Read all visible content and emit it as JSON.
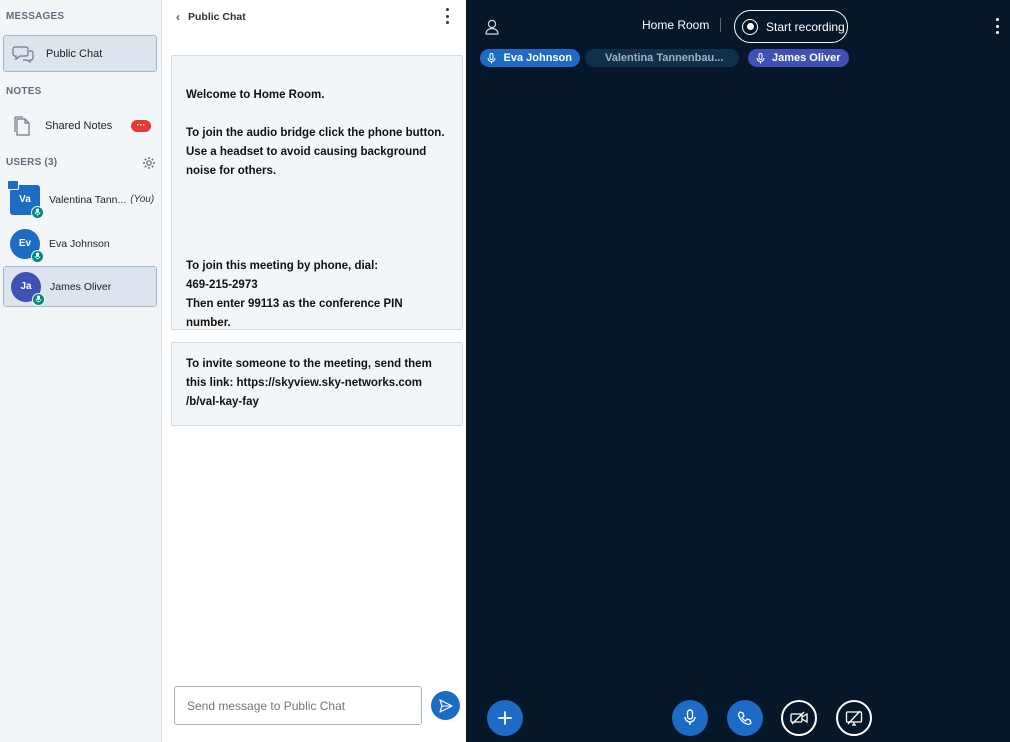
{
  "sidebar": {
    "messages_title": "MESSAGES",
    "public_chat_label": "Public Chat",
    "notes_title": "NOTES",
    "shared_notes_label": "Shared Notes",
    "shared_notes_badge": "···",
    "users_title": "USERS (3)",
    "users": [
      {
        "initials": "Va",
        "name": "Valentina Tann...",
        "you": "(You)",
        "color": "#1e6bc6"
      },
      {
        "initials": "Ev",
        "name": "Eva Johnson",
        "you": "",
        "color": "#1e6bc6"
      },
      {
        "initials": "Ja",
        "name": "James Oliver",
        "you": "",
        "color": "#3f51b5"
      }
    ]
  },
  "chat": {
    "header_title": "Public Chat",
    "welcome_prefix": "Welcome to ",
    "welcome_room": "Home Room.",
    "audio_line": "To join the audio bridge click the phone button. Use a headset to avoid causing background noise for others.",
    "phone_line1": "To join this meeting by phone, dial:",
    "phone_number": "469-215-2973",
    "phone_line3": "Then enter 99113 as the conference PIN number.",
    "invite_line1": "To invite someone to the meeting, send them",
    "invite_line2": "this link: https://skyview.sky-networks.com",
    "invite_line3": "/b/val-kay-fay",
    "input_placeholder": "Send message to Public Chat"
  },
  "main": {
    "room_title": "Home Room",
    "record_label": "Start recording",
    "talkers": [
      {
        "name": "Eva Johnson",
        "color": "#1e6bc6",
        "muted": false
      },
      {
        "name": "Valentina Tannenbau...",
        "color": "#0f2f4a",
        "muted": true
      },
      {
        "name": "James Oliver",
        "color": "#3f51b5",
        "muted": false
      }
    ]
  },
  "colors": {
    "accent": "#1e6bc6",
    "main_bg": "#06172a",
    "sidebar_bg": "#f3f6f9",
    "notification": "#e53935",
    "mic_ok": "#00897b"
  }
}
